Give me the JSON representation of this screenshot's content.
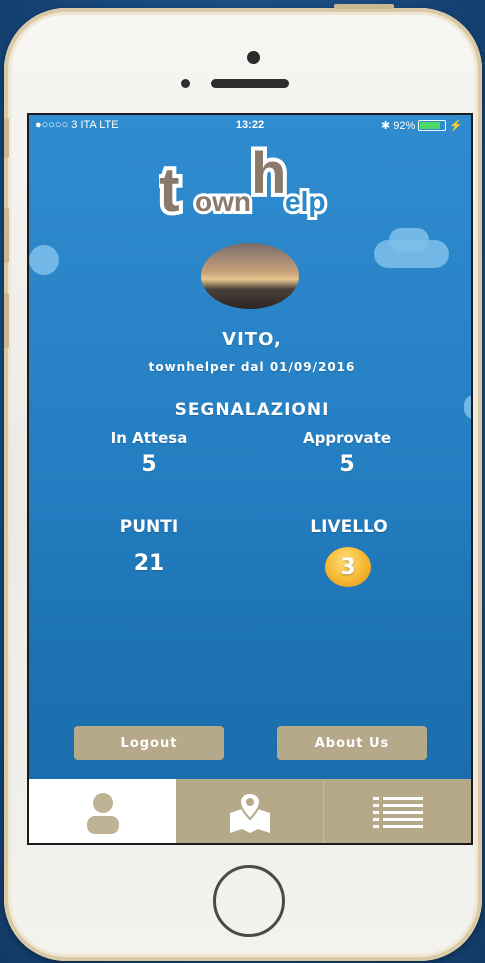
{
  "status_bar": {
    "carrier": "●○○○○ 3 ITA  LTE",
    "time": "13:22",
    "battery_percent": "92%",
    "battery_level": 0.92
  },
  "logo": {
    "part1": "t",
    "part2": "own",
    "part3": "h",
    "part4": "elp"
  },
  "profile": {
    "name": "VITO,",
    "since": "townhelper dal 01/09/2016"
  },
  "reports": {
    "title": "SEGNALAZIONI",
    "pending_label": "In Attesa",
    "pending_value": "5",
    "approved_label": "Approvate",
    "approved_value": "5"
  },
  "stats": {
    "points_label": "PUNTI",
    "points_value": "21",
    "level_label": "LIVELLO",
    "level_value": "3"
  },
  "buttons": {
    "logout": "Logout",
    "about": "About Us"
  },
  "tabs": [
    {
      "icon": "user-icon",
      "active": true
    },
    {
      "icon": "map-icon",
      "active": false
    },
    {
      "icon": "list-icon",
      "active": false
    }
  ],
  "colors": {
    "screen_bg": "#2580c3",
    "button_bg": "#b6a98a",
    "level_badge": "#f6b731"
  }
}
